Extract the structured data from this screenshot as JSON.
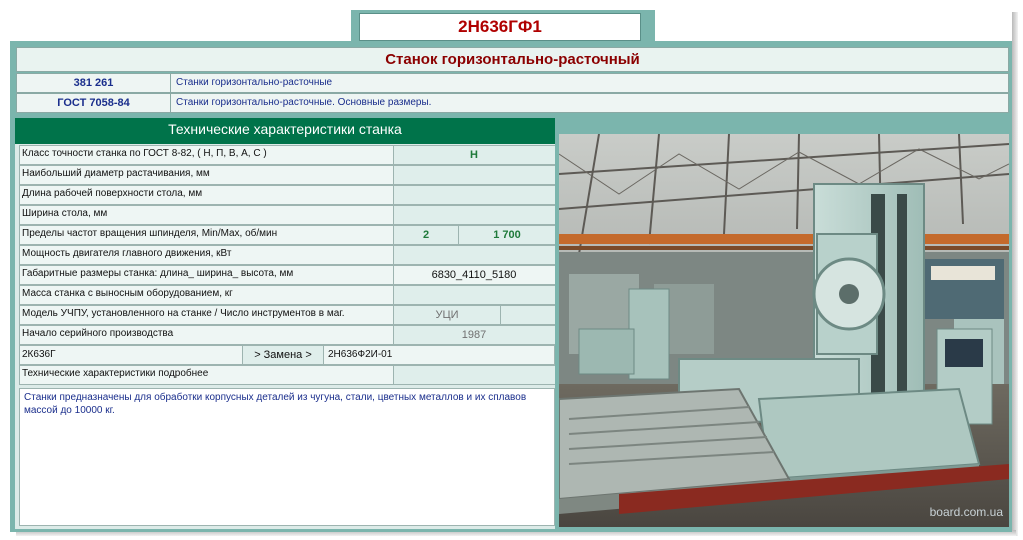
{
  "model": "2Н636ГФ1",
  "machine_type": "Станок горизонтально-расточный",
  "standards": [
    {
      "code": "381 261",
      "desc": "Станки горизонтально-расточные"
    },
    {
      "code": "ГОСТ 7058-84",
      "desc": "Станки горизонтально-расточные. Основные размеры."
    }
  ],
  "specs": {
    "header": "Технические характеристики станка",
    "rows": [
      {
        "label": "Класс точности станка по ГОСТ 8-82,  ( Н, П, В, А, С )",
        "value": "Н"
      },
      {
        "label": "Наибольший диаметр растачивания, мм",
        "value": ""
      },
      {
        "label": "Длина рабочей поверхности стола, мм",
        "value": ""
      },
      {
        "label": "Ширина стола, мм",
        "value": ""
      },
      {
        "label": "Пределы частот вращения шпинделя, Min/Max,  об/мин",
        "min": "2",
        "max": "1 700"
      },
      {
        "label": "Мощность двигателя главного движения, кВт",
        "value": ""
      },
      {
        "label": "Габаритные размеры станка:    длина_ ширина_ высота,  мм",
        "value": "6830_4110_5180"
      },
      {
        "label": "Масса станка с выносным оборудованием, кг",
        "value": ""
      },
      {
        "label": "Модель УЧПУ, установленного на станке / Число инструментов в маг.",
        "value": "УЦИ"
      },
      {
        "label": "Начало серийного производства",
        "value": "1987"
      }
    ],
    "replacement": {
      "old": "2К636Г",
      "label": "> Замена  >",
      "new": "2Н636Ф2И-01"
    },
    "more": "Технические характеристики подробнее",
    "description": "Станки предназначены для обработки корпусных деталей из чугуна, стали, цветных металлов и их сплавов массой до 10000 кг."
  },
  "photo": {
    "watermark": "board.com.ua"
  }
}
